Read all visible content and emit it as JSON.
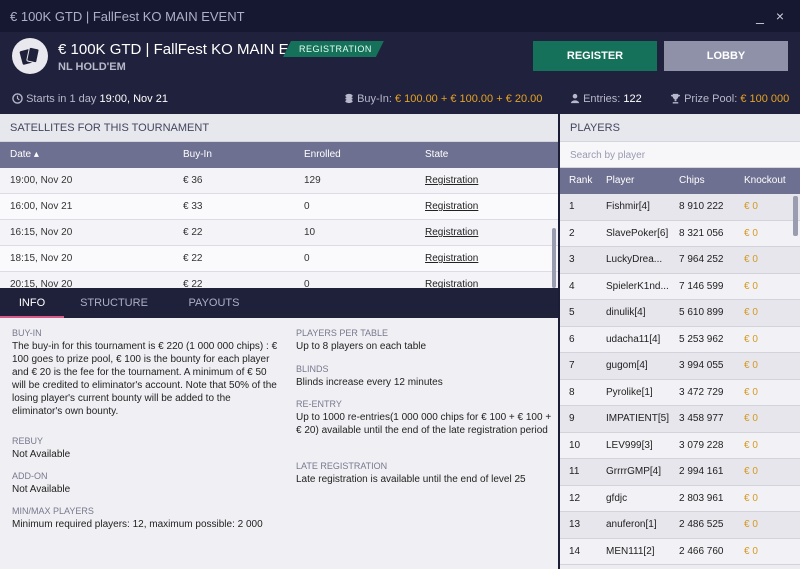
{
  "window": {
    "title": "€ 100K GTD | FallFest KO MAIN EVENT",
    "minimize": "_",
    "close": "×"
  },
  "header": {
    "title": "€ 100K GTD | FallFest KO MAIN E...",
    "subtitle": "NL HOLD'EM",
    "status_badge": "REGISTRATION",
    "register_label": "REGISTER",
    "lobby_label": "LOBBY"
  },
  "infobar": {
    "starts_label": "Starts in 1 day",
    "starts_time": "19:00, Nov 21",
    "buyin_label": "Buy-In:",
    "buyin_value": "€ 100.00 + € 100.00 + € 20.00",
    "entries_label": "Entries:",
    "entries_value": "122",
    "prize_label": "Prize Pool:",
    "prize_value": "€ 100 000"
  },
  "satellites": {
    "section_title": "SATELLITES FOR THIS TOURNAMENT",
    "columns": [
      "Date ▴",
      "Buy-In",
      "Enrolled",
      "State"
    ],
    "rows": [
      {
        "date": "19:00, Nov 20",
        "buyin": "€ 36",
        "enrolled": "129",
        "state": "Registration"
      },
      {
        "date": "16:00, Nov 21",
        "buyin": "€ 33",
        "enrolled": "0",
        "state": "Registration"
      },
      {
        "date": "16:15, Nov 20",
        "buyin": "€ 22",
        "enrolled": "10",
        "state": "Registration"
      },
      {
        "date": "18:15, Nov 20",
        "buyin": "€ 22",
        "enrolled": "0",
        "state": "Registration"
      },
      {
        "date": "20:15, Nov 20",
        "buyin": "€ 22",
        "enrolled": "0",
        "state": "Registration"
      }
    ]
  },
  "tabs": [
    "INFO",
    "STRUCTURE",
    "PAYOUTS"
  ],
  "info": {
    "buyin_label": "BUY-IN",
    "buyin_text": "The buy-in for this tournament is € 220 (1 000 000 chips) : € 100 goes to prize pool, € 100 is the bounty for each player and € 20 is the fee for the tournament. A minimum of € 50 will be credited to eliminator's account. Note that 50% of the losing player's current bounty will be added to the eliminator's own bounty.",
    "rebuy_label": "REBUY",
    "rebuy_text": "Not Available",
    "addon_label": "ADD-ON",
    "addon_text": "Not Available",
    "minmax_label": "MIN/MAX PLAYERS",
    "minmax_text": "Minimum required players: 12, maximum possible: 2 000",
    "ppt_label": "PLAYERS PER TABLE",
    "ppt_text": "Up to 8 players on each table",
    "blinds_label": "BLINDS",
    "blinds_text": "Blinds increase every 12 minutes",
    "reentry_label": "RE-ENTRY",
    "reentry_text": "Up to 1000 re-entries(1 000 000 chips for € 100 + € 100 + € 20) available until the end of the late registration period",
    "late_label": "LATE REGISTRATION",
    "late_text": "Late registration is available until the end of level 25"
  },
  "players": {
    "section_title": "PLAYERS",
    "search_placeholder": "Search by player",
    "columns": [
      "Rank",
      "Player",
      "Chips",
      "Knockout"
    ],
    "rows": [
      {
        "rank": "1",
        "player": "Fishmir[4]",
        "chips": "8 910 222",
        "ko": "€ 0"
      },
      {
        "rank": "2",
        "player": "SlavePoker[6]",
        "chips": "8 321 056",
        "ko": "€ 0"
      },
      {
        "rank": "3",
        "player": "LuckyDrea...",
        "chips": "7 964 252",
        "ko": "€ 0"
      },
      {
        "rank": "4",
        "player": "SpielerK1nd...",
        "chips": "7 146 599",
        "ko": "€ 0"
      },
      {
        "rank": "5",
        "player": "dinulik[4]",
        "chips": "5 610 899",
        "ko": "€ 0"
      },
      {
        "rank": "6",
        "player": "udacha11[4]",
        "chips": "5 253 962",
        "ko": "€ 0"
      },
      {
        "rank": "7",
        "player": "gugom[4]",
        "chips": "3 994 055",
        "ko": "€ 0"
      },
      {
        "rank": "8",
        "player": "Pyrolike[1]",
        "chips": "3 472 729",
        "ko": "€ 0"
      },
      {
        "rank": "9",
        "player": "IMPATIENT[5]",
        "chips": "3 458 977",
        "ko": "€ 0"
      },
      {
        "rank": "10",
        "player": "LEV999[3]",
        "chips": "3 079 228",
        "ko": "€ 0"
      },
      {
        "rank": "11",
        "player": "GrrrrGMP[4]",
        "chips": "2 994 161",
        "ko": "€ 0"
      },
      {
        "rank": "12",
        "player": "gfdjc",
        "chips": "2 803 961",
        "ko": "€ 0"
      },
      {
        "rank": "13",
        "player": "anuferon[1]",
        "chips": "2 486 525",
        "ko": "€ 0"
      },
      {
        "rank": "14",
        "player": "MEN111[2]",
        "chips": "2 466 760",
        "ko": "€ 0"
      }
    ]
  }
}
